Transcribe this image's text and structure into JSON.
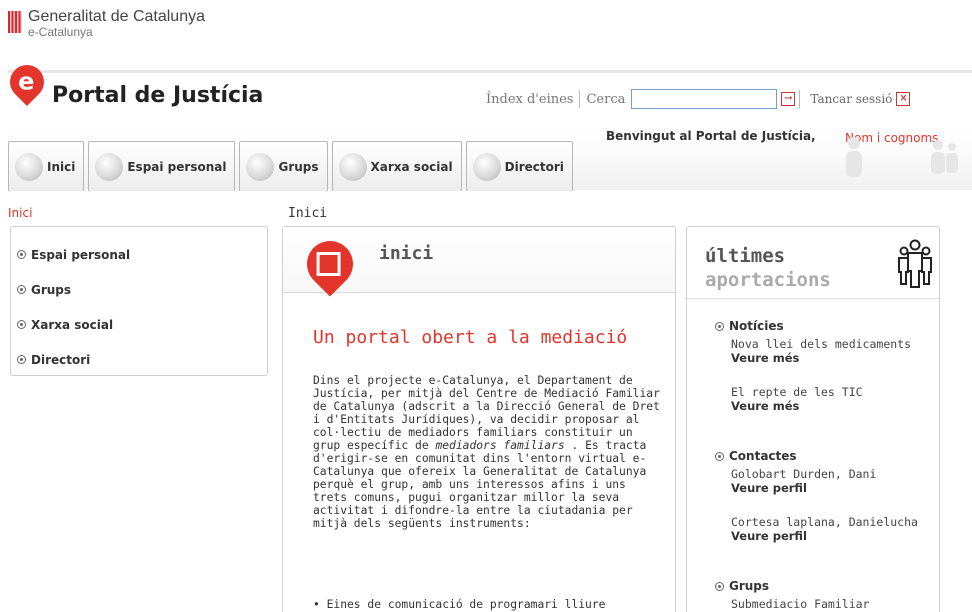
{
  "generalitat": {
    "title": "Generalitat de Catalunya",
    "subtitle": "e-Catalunya"
  },
  "portal": {
    "logo_letter": "e",
    "title": "Portal de Justícia"
  },
  "tools": {
    "index_label": "Índex d'eines",
    "search_label": "Cerca",
    "search_value": "",
    "go_glyph": "→",
    "logout_label": "Tancar sessió",
    "close_glyph": "×"
  },
  "welcome": {
    "text": "Benvingut al Portal de Justícia,",
    "user": "Nom i cognoms"
  },
  "tabs": [
    {
      "label": "Inici",
      "icon": "house-icon"
    },
    {
      "label": "Espai personal",
      "icon": "person-icon"
    },
    {
      "label": "Grups",
      "icon": "group-icon"
    },
    {
      "label": "Xarxa social",
      "icon": "network-icon"
    },
    {
      "label": "Directori",
      "icon": "folder-icon"
    }
  ],
  "breadcrumb_left": "Inici",
  "breadcrumb_main": "Inici",
  "sidebar": {
    "items": [
      "Espai personal",
      "Grups",
      "Xarxa social",
      "Directori"
    ]
  },
  "center": {
    "head_title": "inici",
    "headline": "Un portal obert a la mediació",
    "para_1": "Dins el projecte e-Catalunya, el Departament de Justícia, per mitjà del Centre de Mediació Familiar de Catalunya (adscrit a la Direcció General de Dret i d'Entitats Jurídiques), va decidir proposar al col·lectiu de mediadors familiars constituir un grup específic de",
    "para_italic": "mediadors familiars",
    "para_2": ". Es tracta d'erigir-se en comunitat dins l'entorn virtual e-Catalunya que ofereix la Generalitat de Catalunya perquè el grup, amb uns interessos afins i uns trets comuns, pugui organitzar millor la seva activitat i difondre-la entre la ciutadania per mitjà dels següents instruments:",
    "bullet_1": "• Eines de comunicació de programari lliure"
  },
  "right": {
    "title_1": "últimes",
    "title_2": "aportacions",
    "sections": [
      {
        "title": "Notícies",
        "entries": [
          {
            "text": "Nova llei dels medicaments",
            "link": "Veure més"
          },
          {
            "text": "El repte de les TIC",
            "link": "Veure més"
          }
        ]
      },
      {
        "title": "Contactes",
        "entries": [
          {
            "text": "Golobart Durden, Dani",
            "link": "Veure perfil"
          },
          {
            "text": "Cortesa laplana, Danielucha",
            "link": "Veure perfil"
          }
        ]
      },
      {
        "title": "Grups",
        "entries": [
          {
            "text": "Submediacio Familiar",
            "link": ""
          }
        ]
      }
    ]
  },
  "colors": {
    "accent": "#e3352b",
    "text": "#333333",
    "border": "#cfcfcf"
  }
}
